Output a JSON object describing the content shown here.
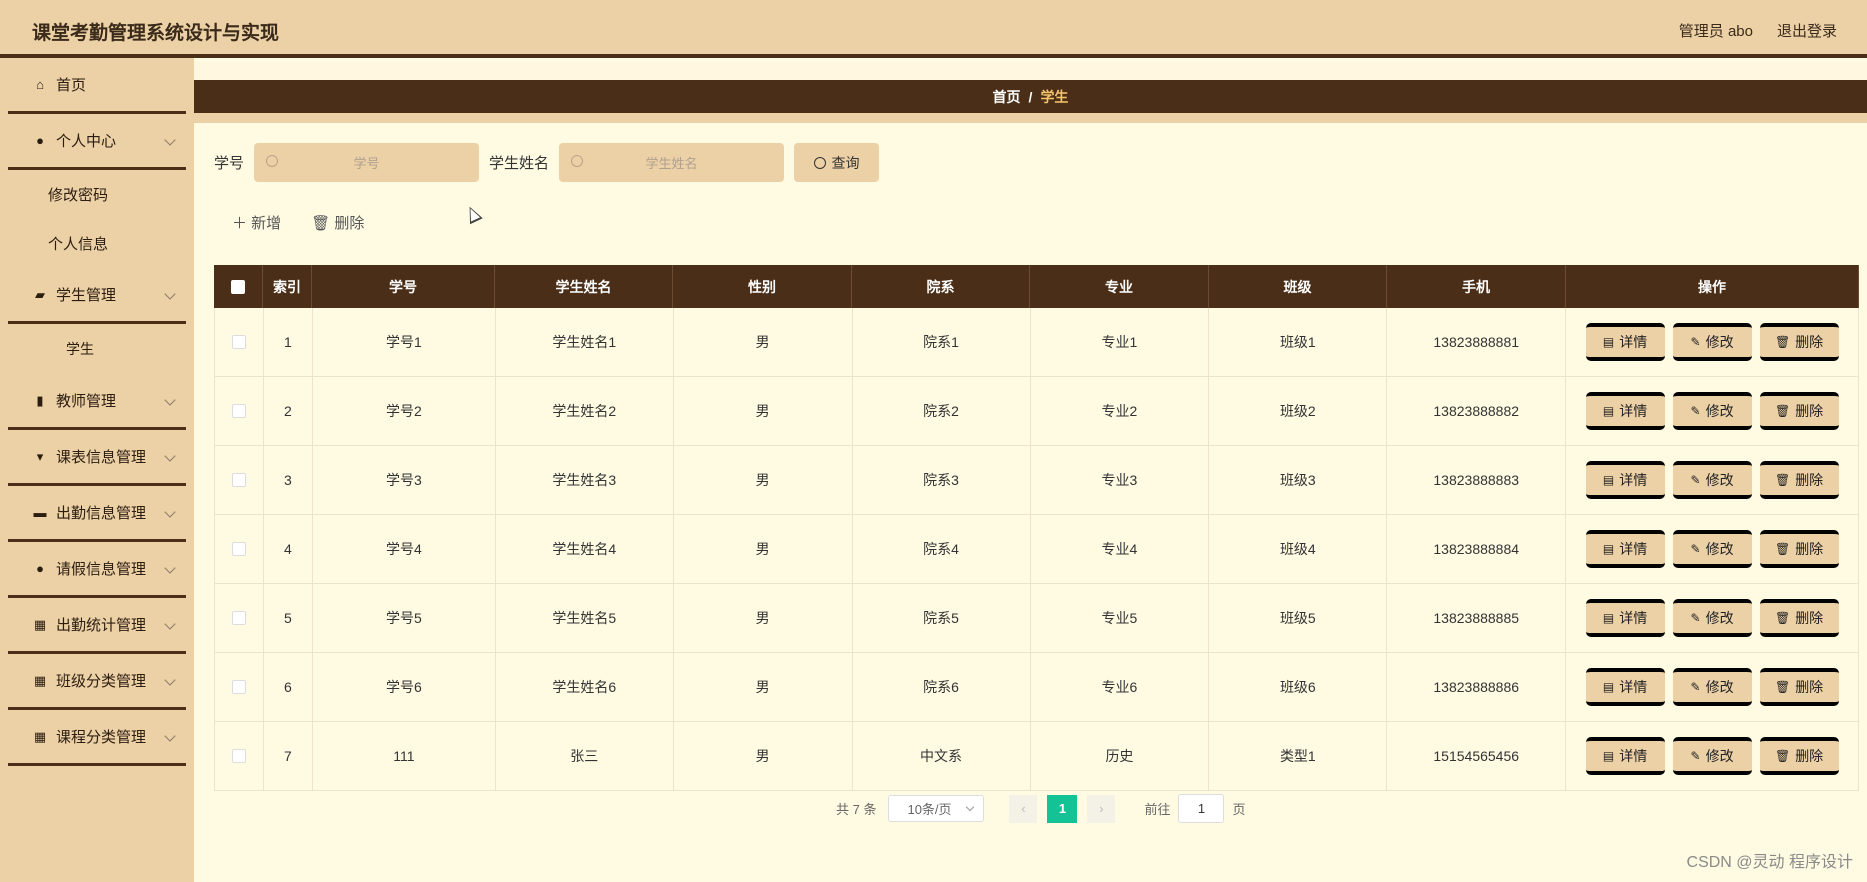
{
  "app": {
    "title": "课堂考勤管理系统设计与实现",
    "user": "管理员 abo",
    "logout": "退出登录"
  },
  "sidebar": {
    "items": [
      {
        "label": "首页",
        "icon": "home-icon"
      },
      {
        "label": "个人中心",
        "icon": "user-icon",
        "subs": [
          "修改密码",
          "个人信息"
        ]
      },
      {
        "label": "学生管理",
        "icon": "student-icon",
        "subs": [
          "学生"
        ]
      },
      {
        "label": "教师管理",
        "icon": "teacher-icon"
      },
      {
        "label": "课表信息管理",
        "icon": "schedule-icon"
      },
      {
        "label": "出勤信息管理",
        "icon": "briefcase-icon"
      },
      {
        "label": "请假信息管理",
        "icon": "bulb-icon"
      },
      {
        "label": "出勤统计管理",
        "icon": "grid-icon"
      },
      {
        "label": "班级分类管理",
        "icon": "grid-icon"
      },
      {
        "label": "课程分类管理",
        "icon": "grid-icon"
      }
    ]
  },
  "breadcrumb": {
    "home": "首页",
    "sep": "/",
    "current": "学生"
  },
  "search": {
    "label1": "学号",
    "placeholder1": "学号",
    "label2": "学生姓名",
    "placeholder2": "学生姓名",
    "button": "查询"
  },
  "toolbar": {
    "add": "新增",
    "delete": "删除"
  },
  "table": {
    "headers": [
      "索引",
      "学号",
      "学生姓名",
      "性别",
      "院系",
      "专业",
      "班级",
      "手机",
      "操作"
    ],
    "rows": [
      [
        "1",
        "学号1",
        "学生姓名1",
        "男",
        "院系1",
        "专业1",
        "班级1",
        "13823888881"
      ],
      [
        "2",
        "学号2",
        "学生姓名2",
        "男",
        "院系2",
        "专业2",
        "班级2",
        "13823888882"
      ],
      [
        "3",
        "学号3",
        "学生姓名3",
        "男",
        "院系3",
        "专业3",
        "班级3",
        "13823888883"
      ],
      [
        "4",
        "学号4",
        "学生姓名4",
        "男",
        "院系4",
        "专业4",
        "班级4",
        "13823888884"
      ],
      [
        "5",
        "学号5",
        "学生姓名5",
        "男",
        "院系5",
        "专业5",
        "班级5",
        "13823888885"
      ],
      [
        "6",
        "学号6",
        "学生姓名6",
        "男",
        "院系6",
        "专业6",
        "班级6",
        "13823888886"
      ],
      [
        "7",
        "111",
        "张三",
        "男",
        "中文系",
        "历史",
        "类型1",
        "15154565456"
      ]
    ],
    "ops": [
      "详情",
      "修改",
      "删除"
    ]
  },
  "pager": {
    "total": "共 7 条",
    "size": "10条/页",
    "page": "1",
    "goto": "前往",
    "goto_value": "1",
    "unit": "页"
  },
  "watermark": "CSDN @灵动 程序设计"
}
